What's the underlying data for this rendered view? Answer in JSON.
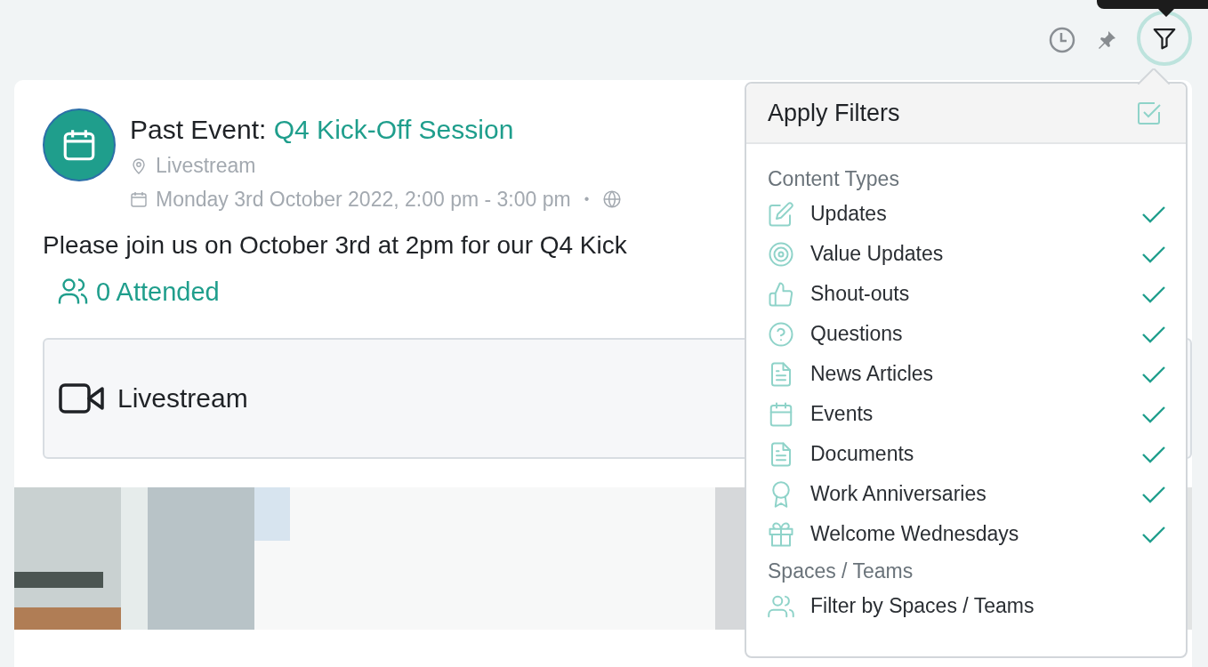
{
  "toolbar": {
    "filter_active": true
  },
  "event": {
    "prefix": "Past Event:",
    "title": "Q4 Kick-Off Session",
    "location": "Livestream",
    "datetime": "Monday 3rd October 2022, 2:00 pm - 3:00 pm",
    "separator": "•",
    "description": "Please join us on October 3rd at 2pm for our Q4 Kick",
    "attended": "0 Attended",
    "stream_label": "Livestream"
  },
  "filters": {
    "title": "Apply Filters",
    "sections": [
      {
        "heading": "Content Types",
        "items": [
          {
            "kind": "option",
            "label": "Updates",
            "checked": true
          },
          {
            "kind": "option",
            "label": "Value Updates",
            "checked": true
          },
          {
            "kind": "option",
            "label": "Shout-outs",
            "checked": true
          },
          {
            "kind": "option",
            "label": "Questions",
            "checked": true
          },
          {
            "kind": "option",
            "label": "News Articles",
            "checked": true
          },
          {
            "kind": "option",
            "label": "Events",
            "checked": true
          },
          {
            "kind": "option",
            "label": "Documents",
            "checked": true
          },
          {
            "kind": "option",
            "label": "Work Anniversaries",
            "checked": true
          },
          {
            "kind": "option",
            "label": "Welcome Wednesdays",
            "checked": true
          }
        ]
      },
      {
        "heading": "Spaces / Teams",
        "items": [
          {
            "kind": "action",
            "label": "Filter by Spaces / Teams"
          }
        ]
      }
    ]
  }
}
